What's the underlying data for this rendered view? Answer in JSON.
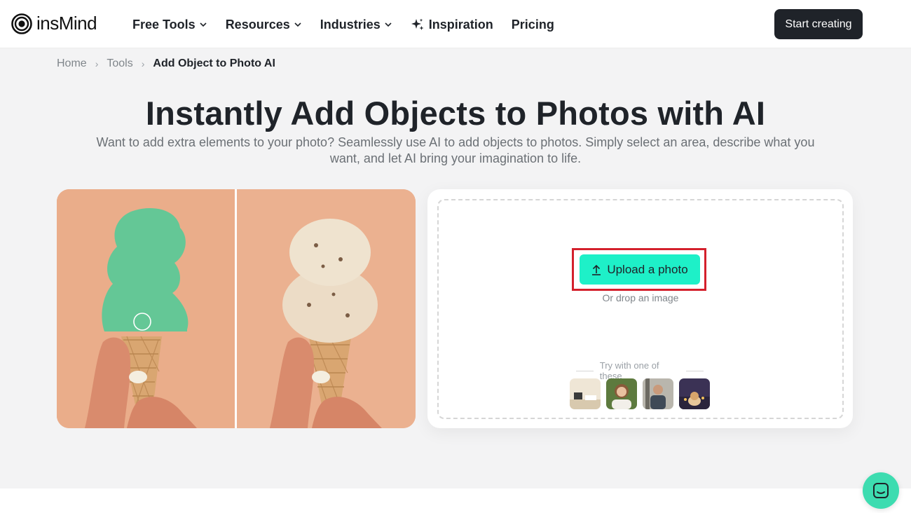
{
  "header": {
    "brand": "insMind",
    "nav": [
      {
        "label": "Free Tools",
        "dropdown": true
      },
      {
        "label": "Resources",
        "dropdown": true
      },
      {
        "label": "Industries",
        "dropdown": true
      },
      {
        "label": "Inspiration",
        "icon": "sparkle-icon"
      },
      {
        "label": "Pricing"
      }
    ],
    "cta_label": "Start creating"
  },
  "breadcrumb": {
    "home": "Home",
    "tools": "Tools",
    "current": "Add Object to Photo AI"
  },
  "hero": {
    "title": "Instantly Add Objects to Photos with AI",
    "subtitle": "Want to add extra elements to your photo? Seamlessly use AI to add objects to photos. Simply select an area, describe what you want, and let AI bring your imagination to life."
  },
  "uploader": {
    "button_label": "Upload a photo",
    "drop_hint": "Or drop an image",
    "try_label": "Try with one of these",
    "samples": [
      "sample-room",
      "sample-woman-portrait",
      "sample-man-portrait",
      "sample-dog-night"
    ]
  },
  "colors": {
    "accent": "#1ef0c8",
    "highlight_frame": "#d4202c",
    "dark": "#1f2329",
    "chat": "#3ddcb0"
  }
}
